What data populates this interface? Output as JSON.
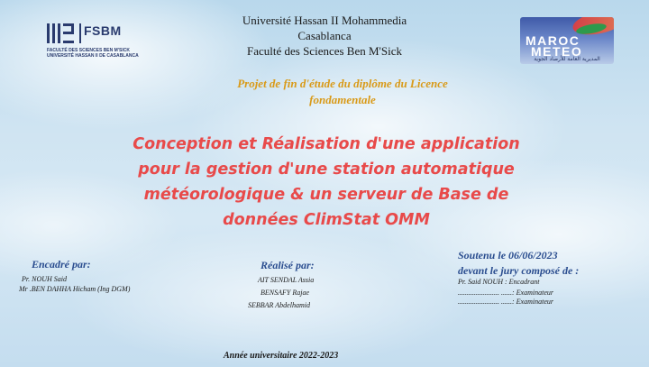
{
  "logos": {
    "fsbm": {
      "name": "FSBM",
      "line1": "FACULTÉ DES SCIENCES BEN M'SICK",
      "line2": "UNIVERSITÉ HASSAN II DE CASABLANCA"
    },
    "meteo": {
      "line1": "MAROC",
      "line2": "METEO",
      "arabic": "المديرية العامة للأرصاد الجوية"
    }
  },
  "header": {
    "university": "Université Hassan II Mohammedia",
    "city": "Casablanca",
    "faculty": "Faculté des Sciences Ben M'Sick"
  },
  "project": {
    "line1": "Projet de fin d'étude du diplôme du Licence",
    "line2": "fondamentale"
  },
  "title": {
    "line1": "Conception et Réalisation d'une application",
    "line2": "pour la gestion  d'une station automatique",
    "line3": "météorologique & un serveur de Base de",
    "line4": "données ClimStat OMM"
  },
  "encadre": {
    "heading": "Encadré par:",
    "names": [
      "Pr. NOUH Said",
      "Mr .BEN DAHHA Hicham (Ing DGM)"
    ]
  },
  "realise": {
    "heading": "Réalisé par:",
    "names": [
      "AIT SENDAL Assia",
      "BENSAFY Rajae",
      "SEBBAR Abdelhamid"
    ]
  },
  "jury": {
    "date": "Soutenu le 06/06/2023",
    "heading": "devant le jury composé de :",
    "members": [
      "Pr. Said NOUH : Encadrant",
      "....................... ......: Examinateur",
      "....................... ......: Examinateur"
    ]
  },
  "footer": {
    "year": "Année universitaire  2022-2023"
  }
}
